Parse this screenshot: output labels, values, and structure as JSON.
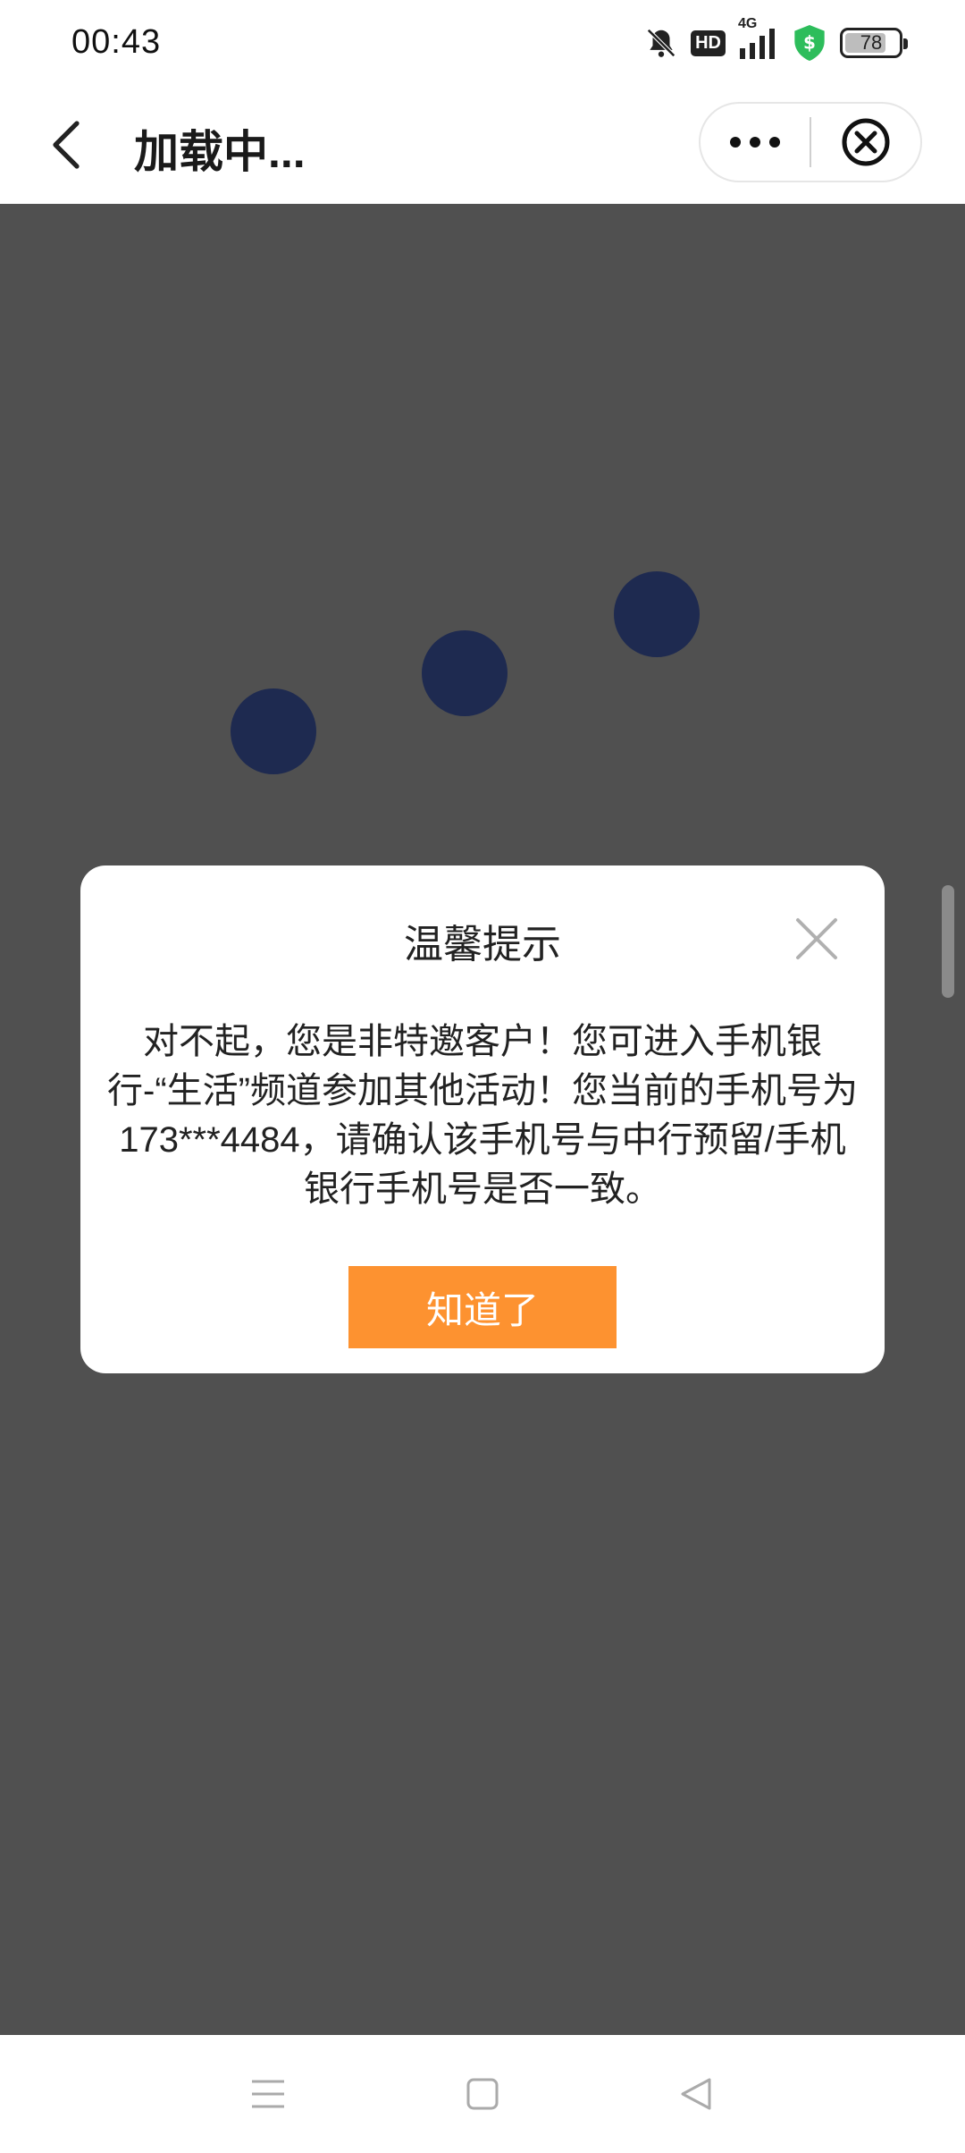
{
  "status_bar": {
    "time": "00:43",
    "network": "4G",
    "hd_label": "HD",
    "battery_level": "78",
    "icons": [
      "bell-muted-icon",
      "hd-icon",
      "signal-4g-icon",
      "security-shield-icon",
      "battery-icon"
    ],
    "shield_color": "#2dbd5b"
  },
  "nav": {
    "title": "加载中...",
    "back_icon": "chevron-left-icon",
    "more_icon": "more-dots-icon",
    "close_icon": "close-circle-icon"
  },
  "loader": {
    "dot_color": "#1e2a50"
  },
  "dialog": {
    "title": "温馨提示",
    "message": "对不起，您是非特邀客户！您可进入手机银行-“生活”频道参加其他活动！您当前的手机号为173***4484，请确认该手机号与中行预留/手机银行手机号是否一致。",
    "confirm_label": "知道了",
    "confirm_color": "#fd9230",
    "close_icon": "close-x-icon"
  },
  "system_nav": {
    "icons": [
      "menu-icon",
      "home-square-icon",
      "back-triangle-icon"
    ]
  }
}
